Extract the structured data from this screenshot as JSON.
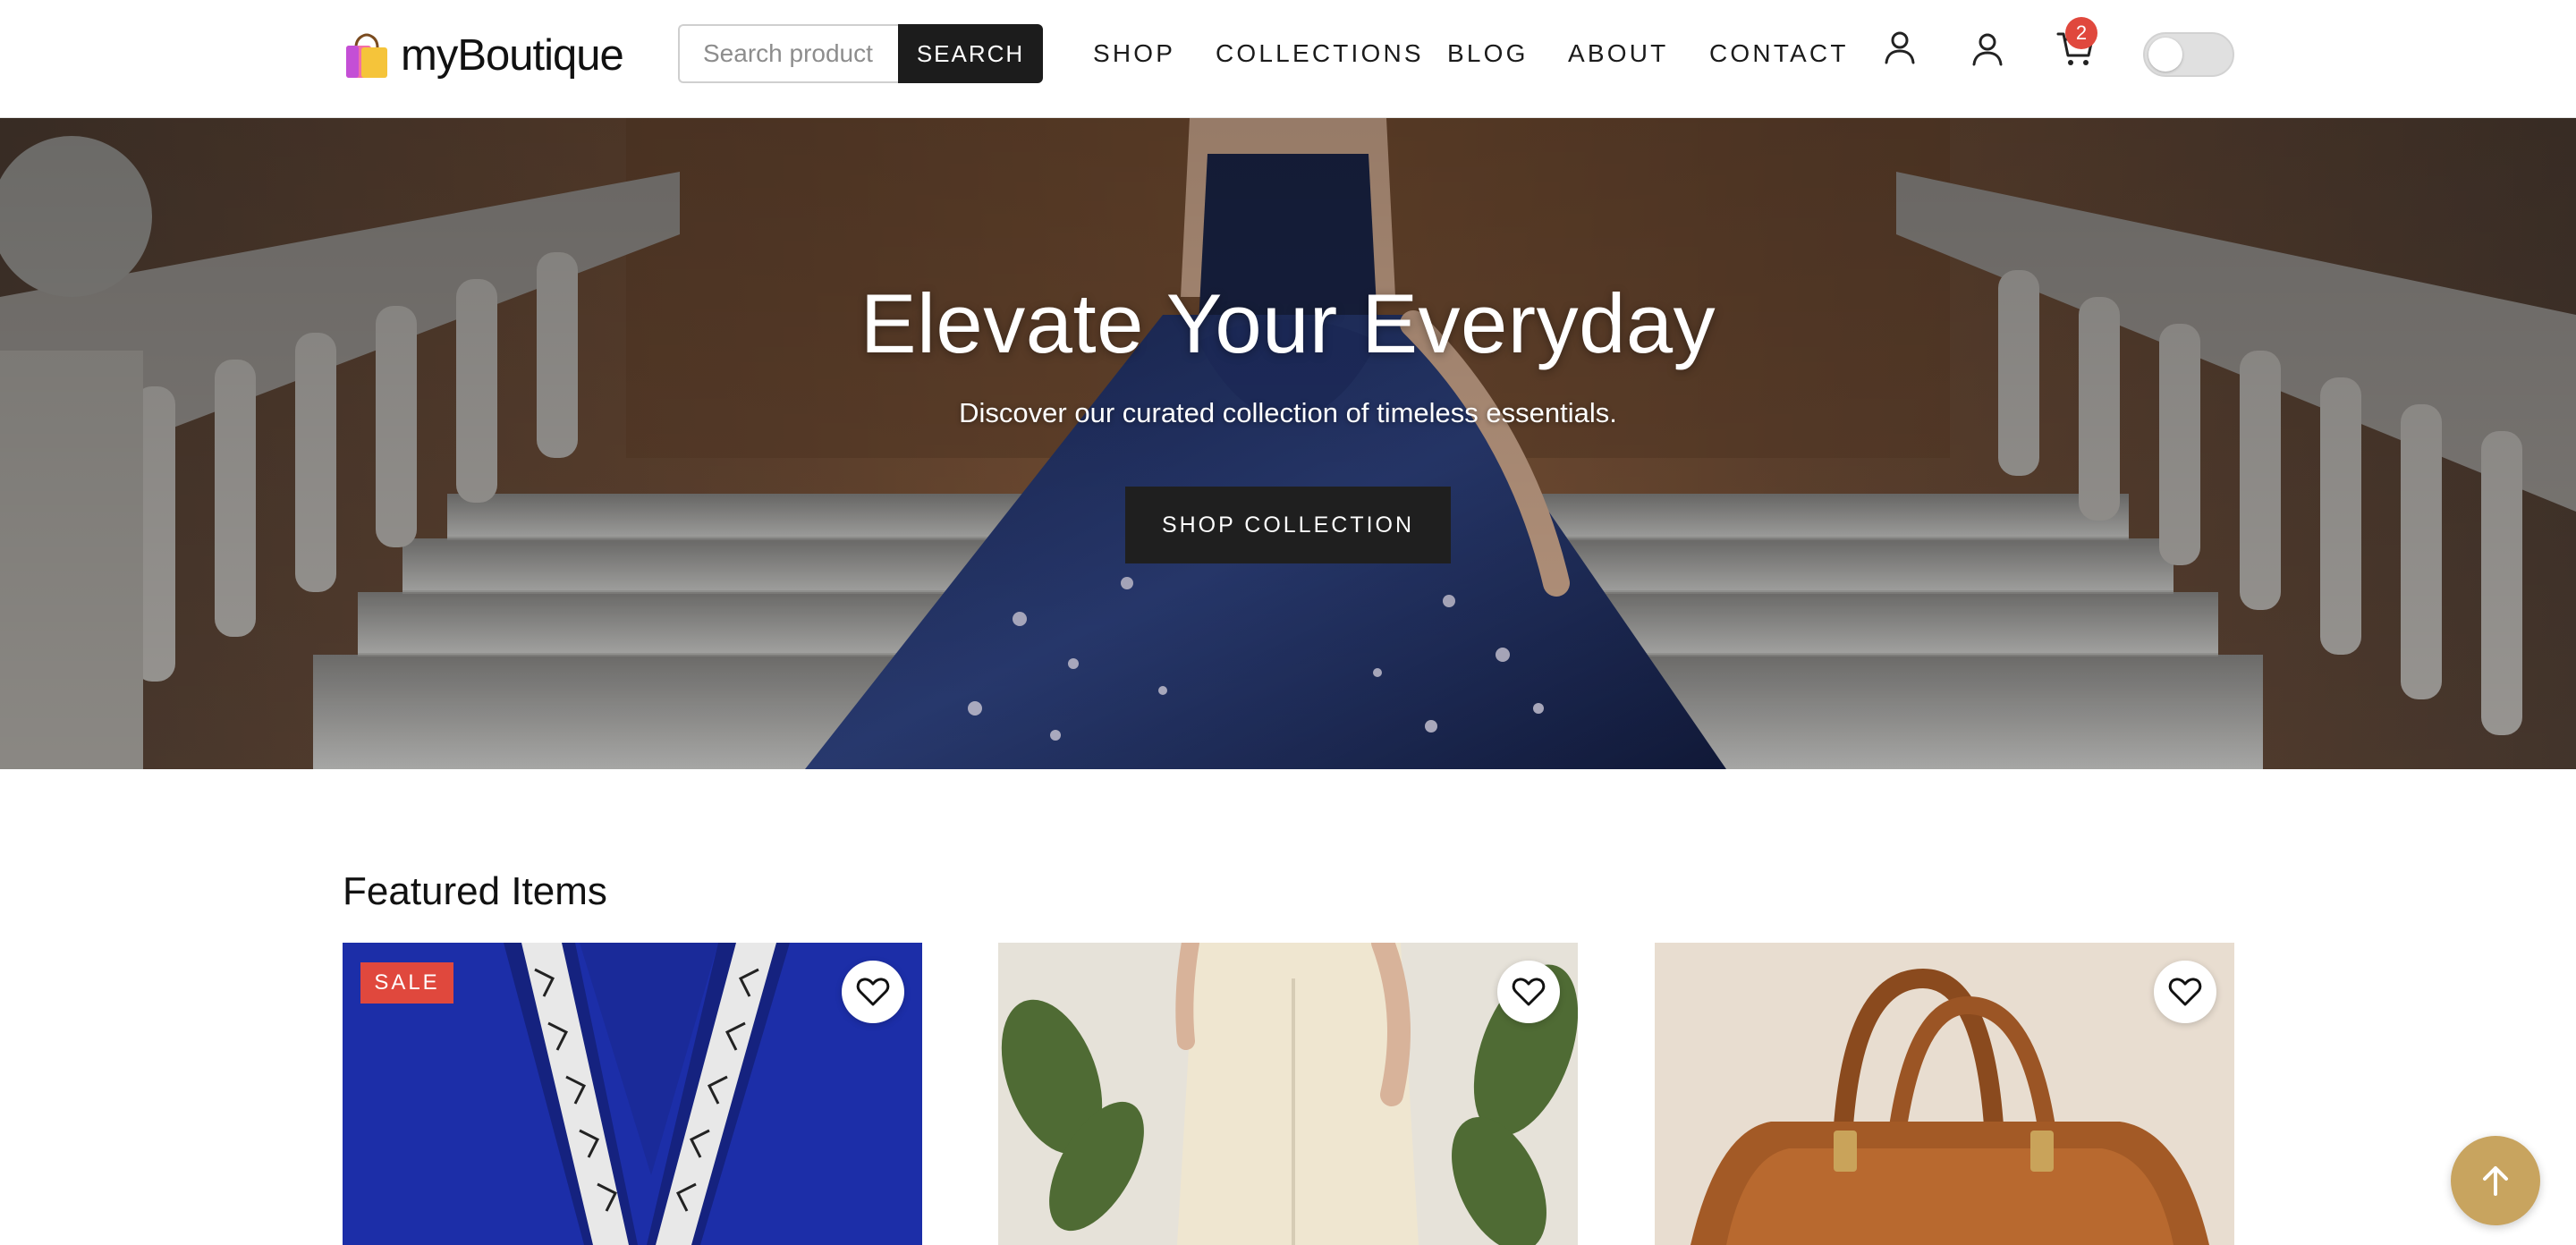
{
  "brand": {
    "name": "myBoutique",
    "logo_icon": "shopping-bag-icon"
  },
  "search": {
    "placeholder": "Search product",
    "value": "",
    "button_label": "SEARCH"
  },
  "nav": {
    "links": [
      "SHOP",
      "COLLECTIONS",
      "BLOG",
      "ABOUT",
      "CONTACT"
    ],
    "icons": [
      "user-icon",
      "account-icon",
      "cart-icon"
    ],
    "cart_count": "2",
    "theme_toggle": "off"
  },
  "hero": {
    "title": "Elevate Your Everyday",
    "subtitle": "Discover our curated collection of timeless essentials.",
    "cta_label": "SHOP COLLECTION"
  },
  "featured": {
    "title": "Featured Items",
    "items": [
      {
        "badge": "SALE",
        "wishlist_icon": "heart-icon"
      },
      {
        "badge": "",
        "wishlist_icon": "heart-icon"
      },
      {
        "badge": "",
        "wishlist_icon": "heart-icon"
      }
    ]
  },
  "scroll_top_icon": "arrow-up-icon",
  "colors": {
    "accent_gold": "#c8a45f",
    "badge_red": "#e0483d",
    "dark_button": "#1c1c1c",
    "navy_dress": "#1c2a5c"
  }
}
